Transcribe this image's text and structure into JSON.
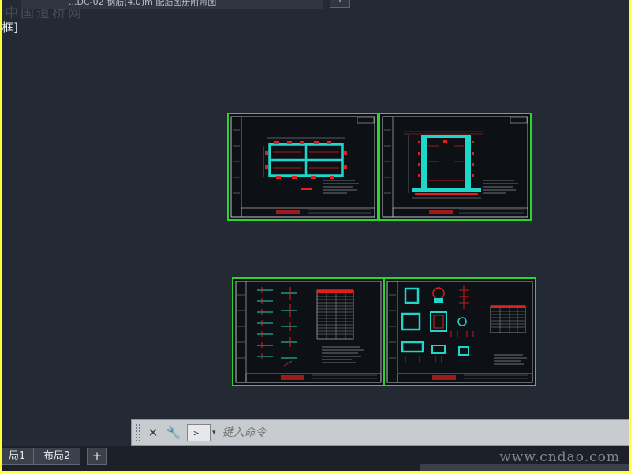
{
  "window": {
    "file_tab_title": "...DC-02 钢筋(4.0)m 配筋图册附带图",
    "new_tab_label": "+",
    "viewport_label": "框]"
  },
  "watermarks": {
    "top": "中国道桥网",
    "bottom": "www.cndao.com"
  },
  "command_line": {
    "close_label": "✕",
    "settings_label": "🔧",
    "prompt_label": ">_",
    "dropdown_label": "▾",
    "placeholder": "键入命令"
  },
  "layout_tabs": {
    "tab1_label": "局1",
    "tab2_label": "布局2",
    "add_label": "+"
  },
  "colors": {
    "background": "#232a34",
    "viewport_border": "#2ad62a",
    "rebar": "#e02020",
    "concrete": "#1fd6c8",
    "outline": "#ffffff"
  }
}
